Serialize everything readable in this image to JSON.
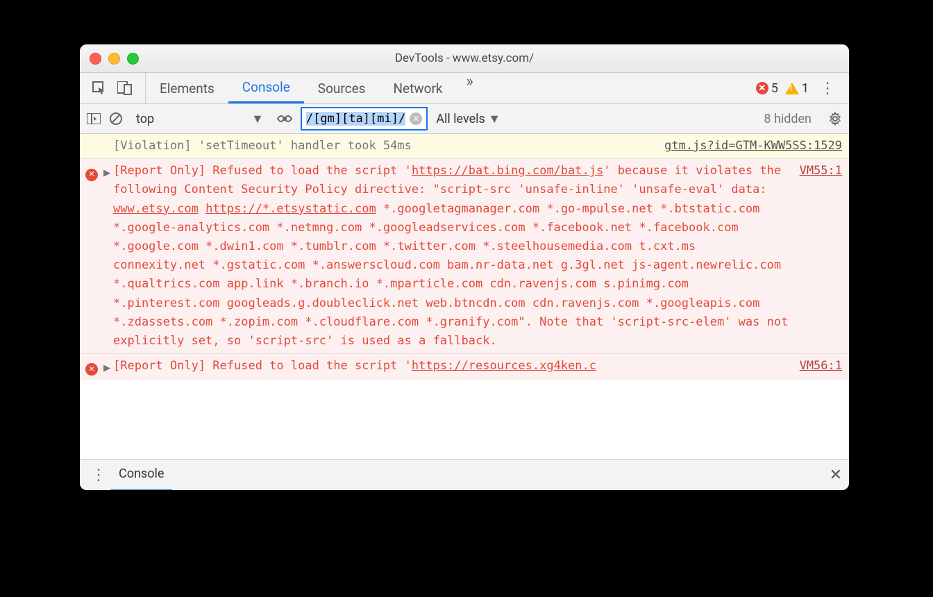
{
  "window": {
    "title": "DevTools - www.etsy.com/"
  },
  "tabs": {
    "elements": "Elements",
    "console": "Console",
    "sources": "Sources",
    "network": "Network"
  },
  "counters": {
    "errors": "5",
    "warnings": "1"
  },
  "filterbar": {
    "context": "top",
    "filter_text": "/[gm][ta][mi]/",
    "levels": "All levels",
    "hidden": "8 hidden"
  },
  "log": {
    "violation_msg": "[Violation] 'setTimeout' handler took 54ms",
    "violation_src": "gtm.js?id=GTM-KWW5SS:1529",
    "err1_pre": "[Report Only] Refused to load the script '",
    "err1_url": "https://bat.bing.com/bat.js",
    "err1_mid1": "' because it violates the following Content Security Policy directive: \"script-src 'unsafe-inline' 'unsafe-eval' data: ",
    "err1_link1": "www.etsy.com",
    "err1_sp": " ",
    "err1_link2": "https://*.etsystatic.com",
    "err1_tail": " *.googletagmanager.com *.go-mpulse.net *.btstatic.com *.google-analytics.com *.netmng.com *.googleadservices.com *.facebook.net *.facebook.com *.google.com *.dwin1.com *.tumblr.com *.twitter.com *.steelhousemedia.com t.cxt.ms connexity.net *.gstatic.com *.answerscloud.com bam.nr-data.net g.3gl.net js-agent.newrelic.com *.qualtrics.com app.link *.branch.io *.mparticle.com cdn.ravenjs.com s.pinimg.com *.pinterest.com googleads.g.doubleclick.net web.btncdn.com cdn.ravenjs.com *.googleapis.com *.zdassets.com *.zopim.com *.cloudflare.com *.granify.com\". Note that 'script-src-elem' was not explicitly set, so 'script-src' is used as a fallback.",
    "err1_src": "VM55:1",
    "err2_pre": "[Report Only] Refused to load the script '",
    "err2_url": "https://resources.xg4ken.c",
    "err2_src": "VM56:1"
  },
  "drawer": {
    "tab": "Console"
  }
}
